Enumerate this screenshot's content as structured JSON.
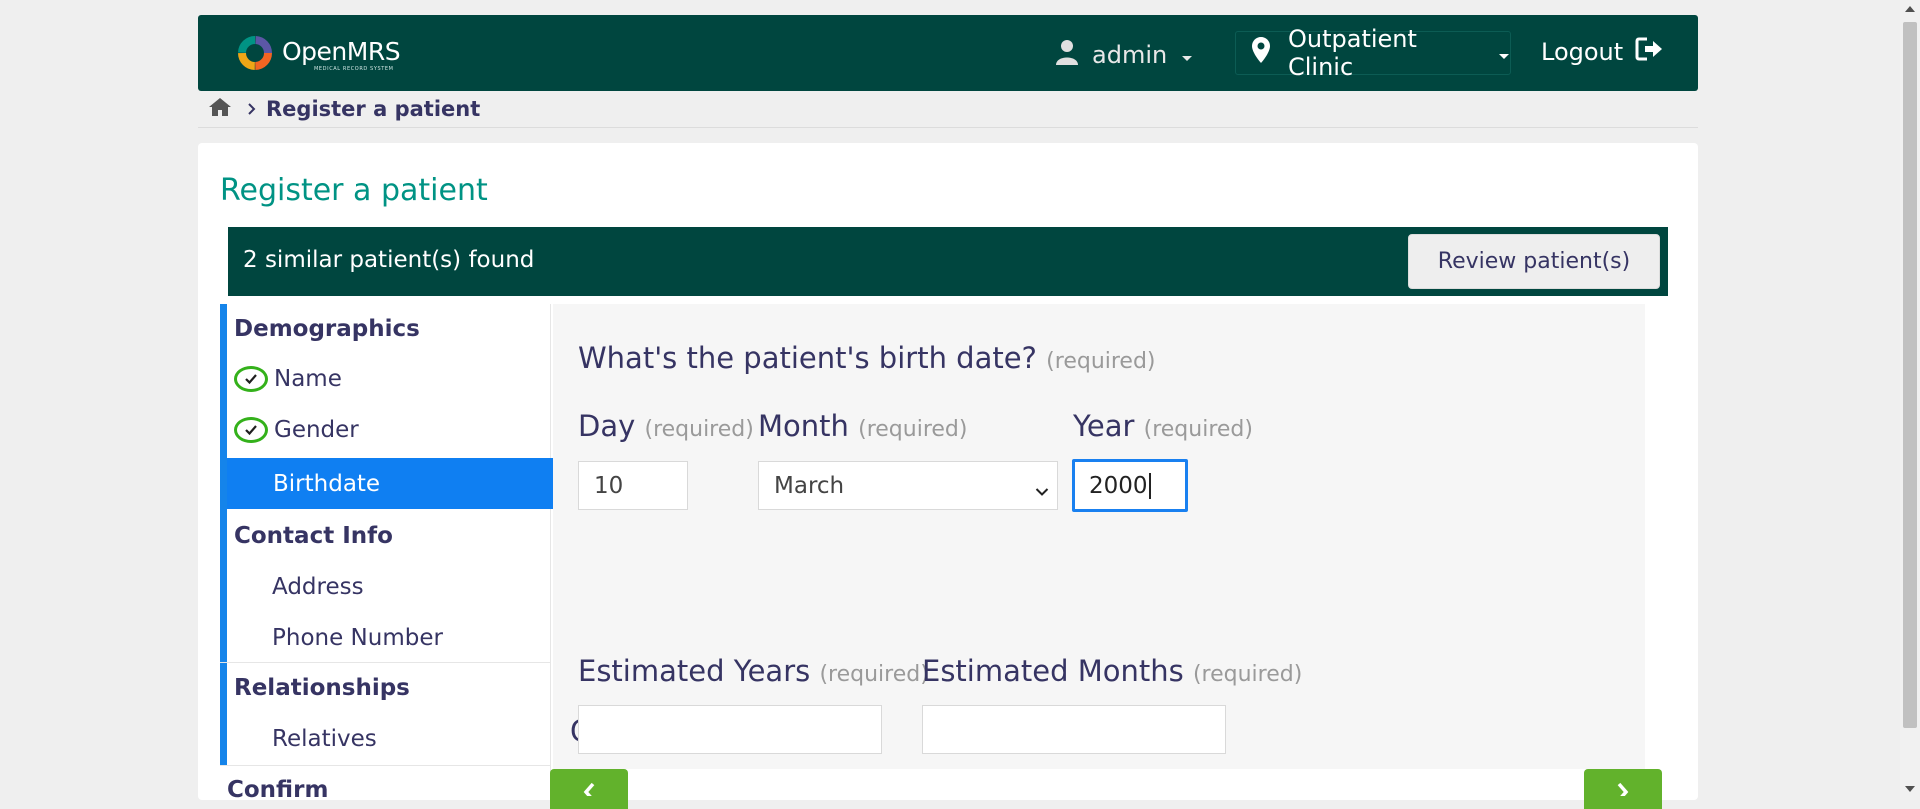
{
  "header": {
    "logo_text": "OpenMRS",
    "logo_subtitle": "MEDICAL RECORD SYSTEM",
    "user": "admin",
    "location": "Outpatient Clinic",
    "logout": "Logout"
  },
  "breadcrumb": {
    "current": "Register a patient"
  },
  "page": {
    "title": "Register a patient"
  },
  "banner": {
    "text": "2 similar patient(s) found",
    "button": "Review patient(s)"
  },
  "sidebar": {
    "demographics": "Demographics",
    "name": "Name",
    "gender": "Gender",
    "birthdate": "Birthdate",
    "contact_info": "Contact Info",
    "address": "Address",
    "phone": "Phone Number",
    "relationships": "Relationships",
    "relatives": "Relatives",
    "confirm": "Confirm"
  },
  "form": {
    "question": "What's the patient's birth date?",
    "required": "(required)",
    "day_label": "Day",
    "day_value": "10",
    "month_label": "Month",
    "month_value": "March",
    "year_label": "Year",
    "year_value": "2000",
    "or": "Or",
    "est_years_label": "Estimated Years",
    "est_years_value": "",
    "est_months_label": "Estimated Months",
    "est_months_value": ""
  },
  "colors": {
    "header_bg": "#00463f",
    "accent_blue": "#0f7ff2",
    "title_teal": "#009384",
    "nav_green": "#62b22c",
    "check_green": "#34b11b"
  }
}
